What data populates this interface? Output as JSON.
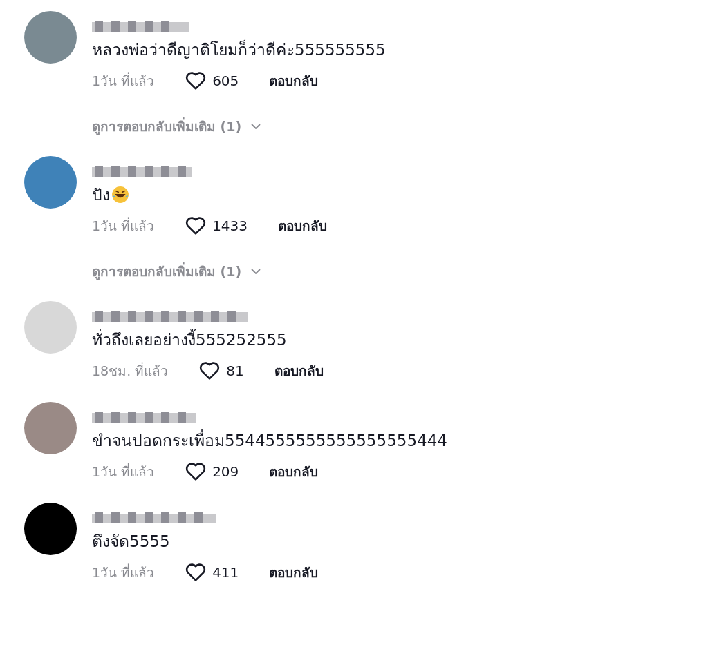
{
  "comments": [
    {
      "color": "#7a8a92",
      "text": "หลวงพ่อว่าดีญาติโยมก็ว่าดีค่ะ555555555",
      "emoji": false,
      "time": "1วัน ที่แล้ว",
      "liked": false,
      "likes": "605",
      "reply": "ตอบกลับ",
      "more_replies": "ดูการตอบกลับเพิ่มเติม (1)"
    },
    {
      "color": "#3f82b8",
      "text": "ปัง",
      "emoji": true,
      "time": "1วัน ที่แล้ว",
      "liked": false,
      "likes": "1433",
      "reply": "ตอบกลับ",
      "more_replies": "ดูการตอบกลับเพิ่มเติม (1)"
    },
    {
      "color": "#d8d8d8",
      "text": "ทั่วถึงเลยอย่างงี้555252555",
      "emoji": false,
      "time": "18ชม. ที่แล้ว",
      "liked": false,
      "likes": "81",
      "reply": "ตอบกลับ"
    },
    {
      "color": "#9a8a86",
      "text": "ขำจนปอดกระเพื่อม5544555555555555555444",
      "emoji": false,
      "time": "1วัน ที่แล้ว",
      "liked": false,
      "likes": "209",
      "reply": "ตอบกลับ"
    },
    {
      "color": "#000000",
      "text": "ตึงจัด5555",
      "emoji": false,
      "time": "1วัน ที่แล้ว",
      "liked": false,
      "likes": "411",
      "reply": "ตอบกลับ"
    }
  ]
}
